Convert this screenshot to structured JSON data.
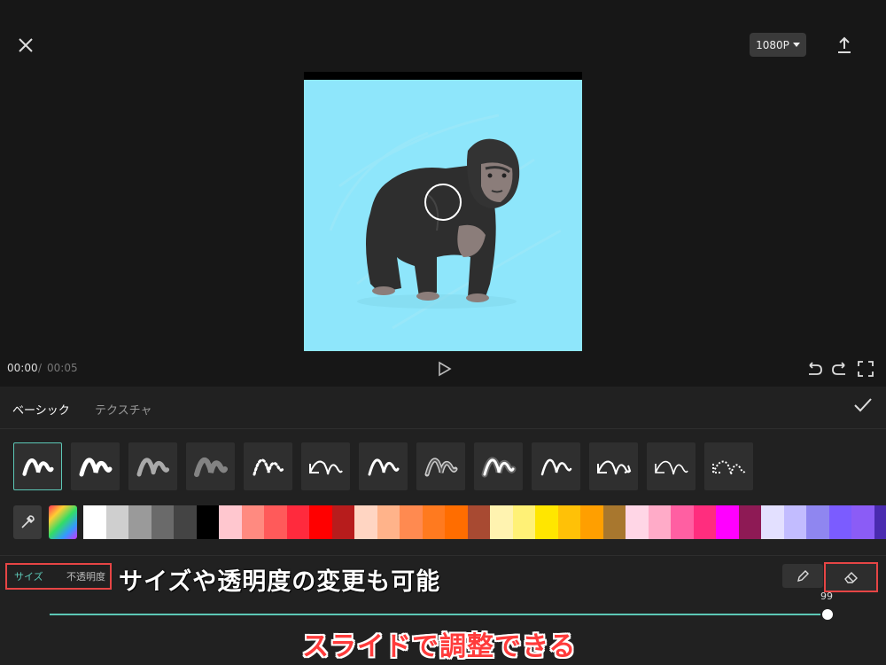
{
  "header": {
    "resolution_label": "1080P",
    "icons": {
      "close": "close-icon",
      "export": "upload-icon",
      "dropdown": "caret-down-icon"
    }
  },
  "player": {
    "current_time": "00:00",
    "separator": "/",
    "total_time": "00:05",
    "icons": {
      "play": "play-icon",
      "undo": "undo-icon",
      "redo": "redo-icon",
      "fullscreen": "fullscreen-icon"
    }
  },
  "tabs": [
    {
      "label": "ベーシック",
      "active": true
    },
    {
      "label": "テクスチャ",
      "active": false
    }
  ],
  "brushes": [
    {
      "style": "solid",
      "selected": true
    },
    {
      "style": "solid-bold",
      "selected": false
    },
    {
      "style": "chalk",
      "selected": false
    },
    {
      "style": "blur",
      "selected": false
    },
    {
      "style": "dotted",
      "selected": false
    },
    {
      "style": "arrow-start",
      "selected": false
    },
    {
      "style": "marker",
      "selected": false
    },
    {
      "style": "outline-gray",
      "selected": false
    },
    {
      "style": "neon",
      "selected": false
    },
    {
      "style": "thin",
      "selected": false
    },
    {
      "style": "double-arrow",
      "selected": false
    },
    {
      "style": "arrow-start-thin",
      "selected": false
    },
    {
      "style": "dotted-arrow",
      "selected": false
    }
  ],
  "colors": [
    "#ffffff",
    "#cfcfcf",
    "#9a9a9a",
    "#6a6a6a",
    "#444444",
    "#000000",
    "#ffc7cf",
    "#ff8a80",
    "#ff5a5a",
    "#ff2a3d",
    "#ff0000",
    "#b71c1c",
    "#ffd5c2",
    "#ffb38a",
    "#ff8a50",
    "#ff7a1f",
    "#ff6d00",
    "#a84a32",
    "#fff3b0",
    "#fff176",
    "#ffe600",
    "#ffc107",
    "#ff9f00",
    "#a8772e",
    "#ffd6e6",
    "#ffabc8",
    "#ff5fa2",
    "#ff2d7e",
    "#ff00ff",
    "#8e1a55",
    "#e3e0ff",
    "#c2bcff",
    "#8f86f0",
    "#7b5cff",
    "#8b5cf6",
    "#4a2bb0"
  ],
  "properties": {
    "size_label": "サイズ",
    "opacity_label": "不透明度",
    "slider_value": 99,
    "slider_value_text": "99",
    "slider_max": 100,
    "icons": {
      "pen": "pen-icon",
      "eraser": "eraser-icon",
      "eyedropper": "eyedropper-icon",
      "confirm": "check-icon"
    }
  },
  "annotations": {
    "size_note": "サイズや透明度の変更も可能",
    "slider_note": "スライドで調整できる"
  },
  "theme": {
    "accent": "#5cc7b6",
    "highlight": "#e64545",
    "canvas_bg": "#8ee6fb"
  }
}
